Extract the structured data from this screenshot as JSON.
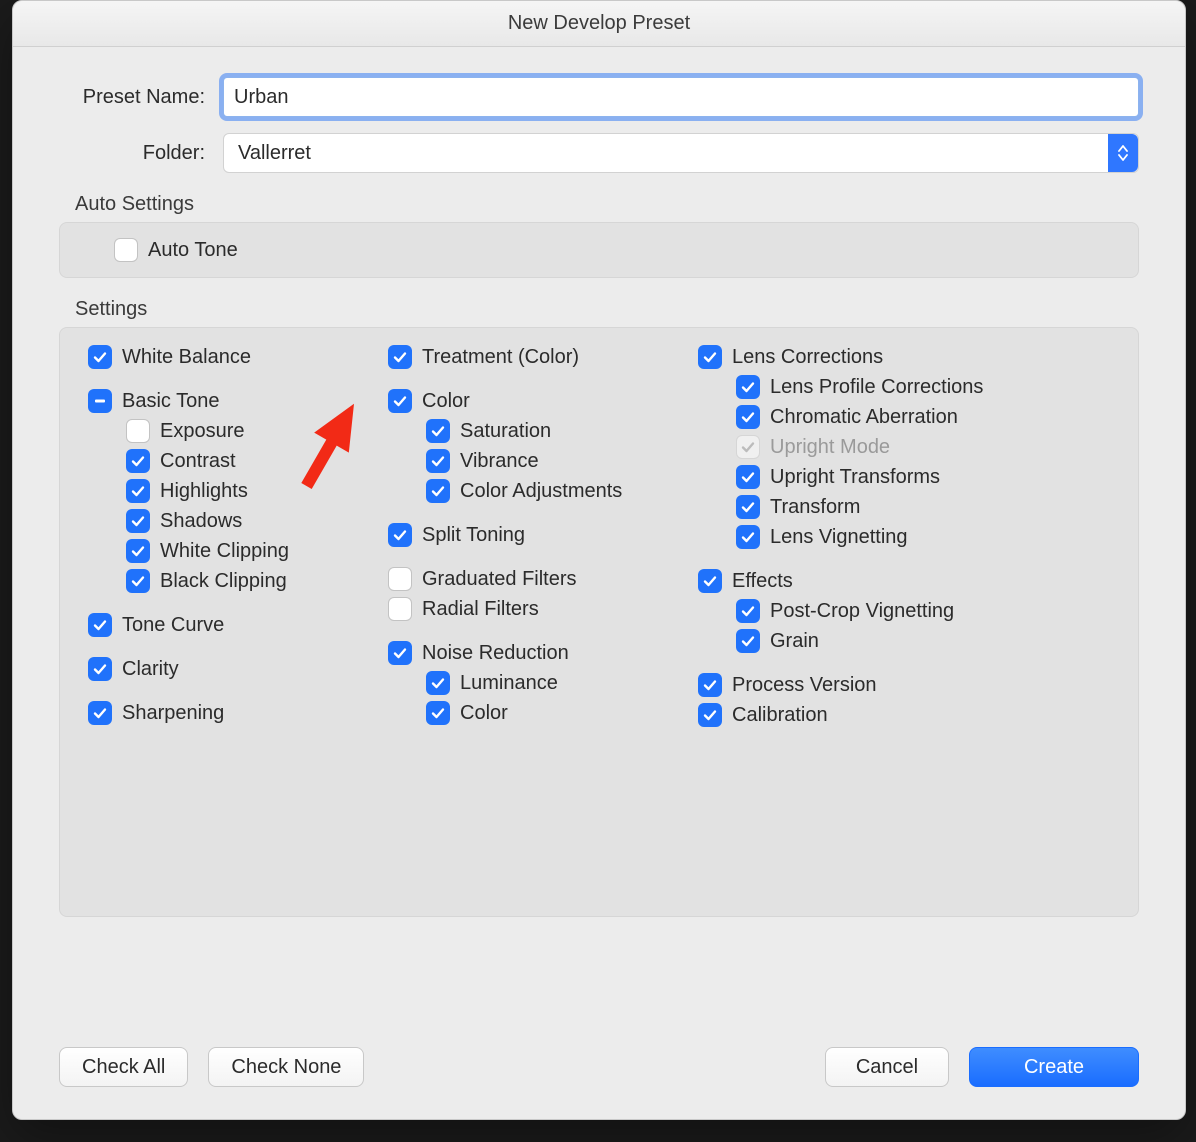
{
  "window": {
    "title": "New Develop Preset"
  },
  "form": {
    "preset_label": "Preset Name:",
    "preset_value": "Urban",
    "folder_label": "Folder:",
    "folder_value": "Vallerret"
  },
  "auto_settings": {
    "title": "Auto Settings",
    "auto_tone": {
      "label": "Auto Tone",
      "state": "unchecked"
    }
  },
  "settings": {
    "title": "Settings",
    "col1": {
      "white_balance": {
        "label": "White Balance",
        "state": "checked"
      },
      "basic_tone": {
        "label": "Basic Tone",
        "state": "mixed",
        "children": {
          "exposure": {
            "label": "Exposure",
            "state": "unchecked"
          },
          "contrast": {
            "label": "Contrast",
            "state": "checked"
          },
          "highlights": {
            "label": "Highlights",
            "state": "checked"
          },
          "shadows": {
            "label": "Shadows",
            "state": "checked"
          },
          "white_clipping": {
            "label": "White Clipping",
            "state": "checked"
          },
          "black_clipping": {
            "label": "Black Clipping",
            "state": "checked"
          }
        }
      },
      "tone_curve": {
        "label": "Tone Curve",
        "state": "checked"
      },
      "clarity": {
        "label": "Clarity",
        "state": "checked"
      },
      "sharpening": {
        "label": "Sharpening",
        "state": "checked"
      }
    },
    "col2": {
      "treatment": {
        "label": "Treatment (Color)",
        "state": "checked"
      },
      "color": {
        "label": "Color",
        "state": "checked",
        "children": {
          "saturation": {
            "label": "Saturation",
            "state": "checked"
          },
          "vibrance": {
            "label": "Vibrance",
            "state": "checked"
          },
          "color_adjustments": {
            "label": "Color Adjustments",
            "state": "checked"
          }
        }
      },
      "split_toning": {
        "label": "Split Toning",
        "state": "checked"
      },
      "graduated_filters": {
        "label": "Graduated Filters",
        "state": "unchecked"
      },
      "radial_filters": {
        "label": "Radial Filters",
        "state": "unchecked"
      },
      "noise_reduction": {
        "label": "Noise Reduction",
        "state": "checked",
        "children": {
          "luminance": {
            "label": "Luminance",
            "state": "checked"
          },
          "color": {
            "label": "Color",
            "state": "checked"
          }
        }
      }
    },
    "col3": {
      "lens_corrections": {
        "label": "Lens Corrections",
        "state": "checked",
        "children": {
          "lens_profile": {
            "label": "Lens Profile Corrections",
            "state": "checked"
          },
          "chromatic_aberration": {
            "label": "Chromatic Aberration",
            "state": "checked"
          },
          "upright_mode": {
            "label": "Upright Mode",
            "state": "disabled"
          },
          "upright_transforms": {
            "label": "Upright Transforms",
            "state": "checked"
          },
          "transform": {
            "label": "Transform",
            "state": "checked"
          },
          "lens_vignetting": {
            "label": "Lens Vignetting",
            "state": "checked"
          }
        }
      },
      "effects": {
        "label": "Effects",
        "state": "checked",
        "children": {
          "post_crop_vignetting": {
            "label": "Post-Crop Vignetting",
            "state": "checked"
          },
          "grain": {
            "label": "Grain",
            "state": "checked"
          }
        }
      },
      "process_version": {
        "label": "Process Version",
        "state": "checked"
      },
      "calibration": {
        "label": "Calibration",
        "state": "checked"
      }
    }
  },
  "footer": {
    "check_all": "Check All",
    "check_none": "Check None",
    "cancel": "Cancel",
    "create": "Create"
  },
  "colors": {
    "accent": "#2072fb",
    "arrow": "#f22a16"
  }
}
